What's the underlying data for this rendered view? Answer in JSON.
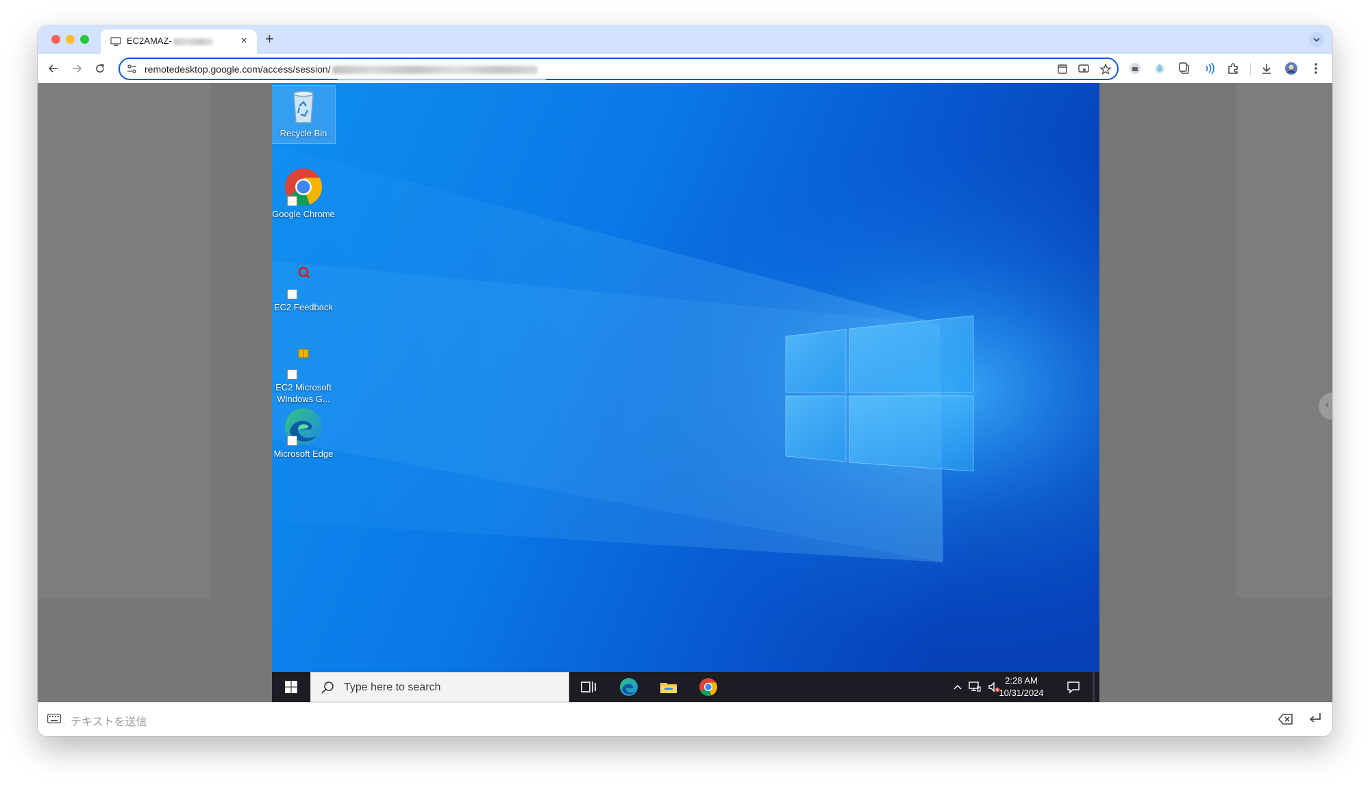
{
  "browser": {
    "tab": {
      "title": "EC2AMAZ-",
      "favicon": "remote-desktop-icon"
    },
    "url": "remotedesktop.google.com/access/session/",
    "new_tab_symbol": "+",
    "close_tab_symbol": "×",
    "accent_color": "#0b57d0",
    "tabstrip_color": "#d3e3fd"
  },
  "desktop": {
    "icons": [
      {
        "label": "Recycle Bin",
        "icon": "recycle-bin-icon"
      },
      {
        "label": "Google Chrome",
        "icon": "chrome-icon"
      },
      {
        "label": "EC2 Feedback",
        "icon": "feedback-icon"
      },
      {
        "label": "EC2 Microsoft Windows G...",
        "icon": "package-icon"
      },
      {
        "label": "Microsoft Edge",
        "icon": "edge-icon"
      }
    ],
    "wallpaper_color": "#0b5fd8"
  },
  "taskbar": {
    "search_placeholder": "Type here to search",
    "pinned": [
      "task-view-icon",
      "edge-icon",
      "file-explorer-icon",
      "chrome-icon"
    ],
    "clock": {
      "time": "2:28 AM",
      "date": "10/31/2024"
    }
  },
  "input_bar": {
    "placeholder": "テキストを送信"
  }
}
